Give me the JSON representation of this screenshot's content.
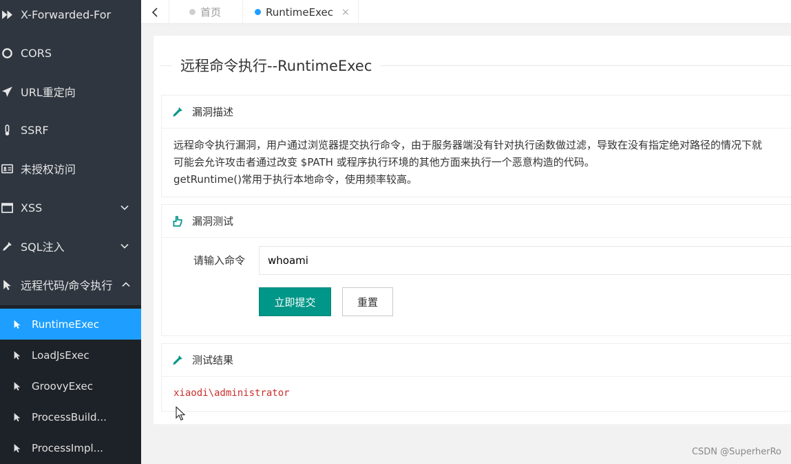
{
  "sidebar": {
    "items": [
      {
        "label": "X-Forwarded-For",
        "icon": "forward-icon"
      },
      {
        "label": "CORS",
        "icon": "circle-icon"
      },
      {
        "label": "URL重定向",
        "icon": "plane-icon"
      },
      {
        "label": "SSRF",
        "icon": "thermometer-icon"
      },
      {
        "label": "未授权访问",
        "icon": "id-card-icon"
      },
      {
        "label": "XSS",
        "icon": "window-icon"
      },
      {
        "label": "SQL注入",
        "icon": "dropper-icon"
      },
      {
        "label": "远程代码/命令执行",
        "icon": "pointer-icon"
      }
    ],
    "submenu": [
      {
        "label": "RuntimeExec",
        "active": true
      },
      {
        "label": "LoadJsExec"
      },
      {
        "label": "GroovyExec"
      },
      {
        "label": "ProcessBuild..."
      },
      {
        "label": "ProcessImpl..."
      }
    ]
  },
  "tabs": {
    "home": "首页",
    "current": "RuntimeExec",
    "close": "×"
  },
  "page": {
    "title": "远程命令执行--RuntimeExec"
  },
  "vuln_desc": {
    "heading": "漏洞描述",
    "lines": [
      "远程命令执行漏洞，用户通过浏览器提交执行命令，由于服务器端没有针对执行函数做过滤，导致在没有指定绝对路径的情况下就",
      "可能会允许攻击者通过改变 $PATH 或程序执行环境的其他方面来执行一个恶意构造的代码。",
      "getRuntime()常用于执行本地命令，使用频率较高。"
    ]
  },
  "vuln_test": {
    "heading": "漏洞测试",
    "input_label": "请输入命令",
    "input_value": "whoami",
    "submit_label": "立即提交",
    "reset_label": "重置"
  },
  "test_result": {
    "heading": "测试结果",
    "output": "xiaodi\\administrator"
  },
  "watermark": "CSDN @SuperherRo",
  "colors": {
    "sidebar_bg": "#2f3640",
    "submenu_bg": "#1d2228",
    "active": "#1e9fff",
    "primary_button": "#009688",
    "result_text": "#c9302c"
  }
}
